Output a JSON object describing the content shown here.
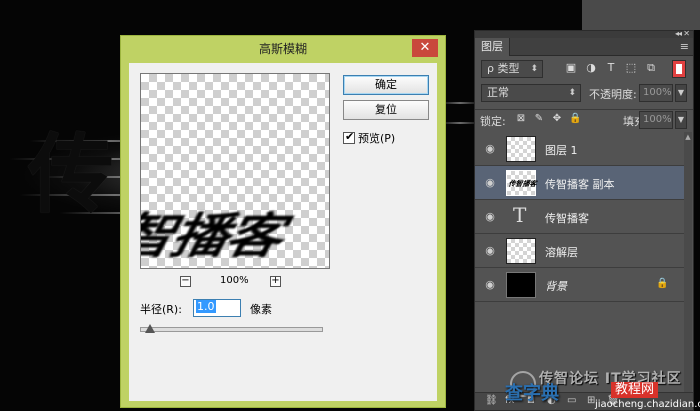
{
  "canvas": {
    "bg_char": "传"
  },
  "dialog": {
    "title": "高斯模糊",
    "close_symbol": "✕",
    "preview_text": "智播客",
    "zoom_out": "−",
    "zoom_in": "+",
    "zoom_level": "100%",
    "ok_label": "确定",
    "reset_label": "复位",
    "preview_checkbox_label": "预览(P)",
    "preview_checked": true,
    "radius_label": "半径(R):",
    "radius_value": "1.0",
    "radius_unit": "像素"
  },
  "layers_panel": {
    "tab_label": "图层",
    "collapse_icon": "◂◂",
    "close_icon": "✕",
    "menu_icon": "≡",
    "filter_label": "ρ 类型",
    "blend_mode": "正常",
    "opacity_label": "不透明度:",
    "opacity_value": "100%",
    "lock_label": "锁定:",
    "fill_label": "填充:",
    "fill_value": "100%",
    "layers": [
      {
        "name": "图层 1",
        "kind": "pixel",
        "selected": false,
        "visible": true
      },
      {
        "name": "传智播客 副本",
        "kind": "pixel",
        "selected": true,
        "visible": true,
        "thumb_text": "传智播客"
      },
      {
        "name": "传智播客",
        "kind": "text",
        "selected": false,
        "visible": true
      },
      {
        "name": "溶解层",
        "kind": "pixel",
        "selected": false,
        "visible": true
      },
      {
        "name": "背景",
        "kind": "background",
        "selected": false,
        "visible": true,
        "locked": true
      }
    ],
    "text_layer_icon": "T",
    "eye_icon": "◉",
    "lock_icon": "🔒"
  },
  "watermark": {
    "top_text": "传智论坛 IT学习社区",
    "main_text_a": "查字典",
    "main_text_b": "",
    "badge": "教程网",
    "url": "jiaocheng.chazidian.com"
  },
  "colors": {
    "dialog_frame": "#bfd264",
    "dialog_close": "#c9483c",
    "panel_bg": "#535353",
    "selected_layer": "#596476",
    "filter_toggle": "#e04040"
  }
}
